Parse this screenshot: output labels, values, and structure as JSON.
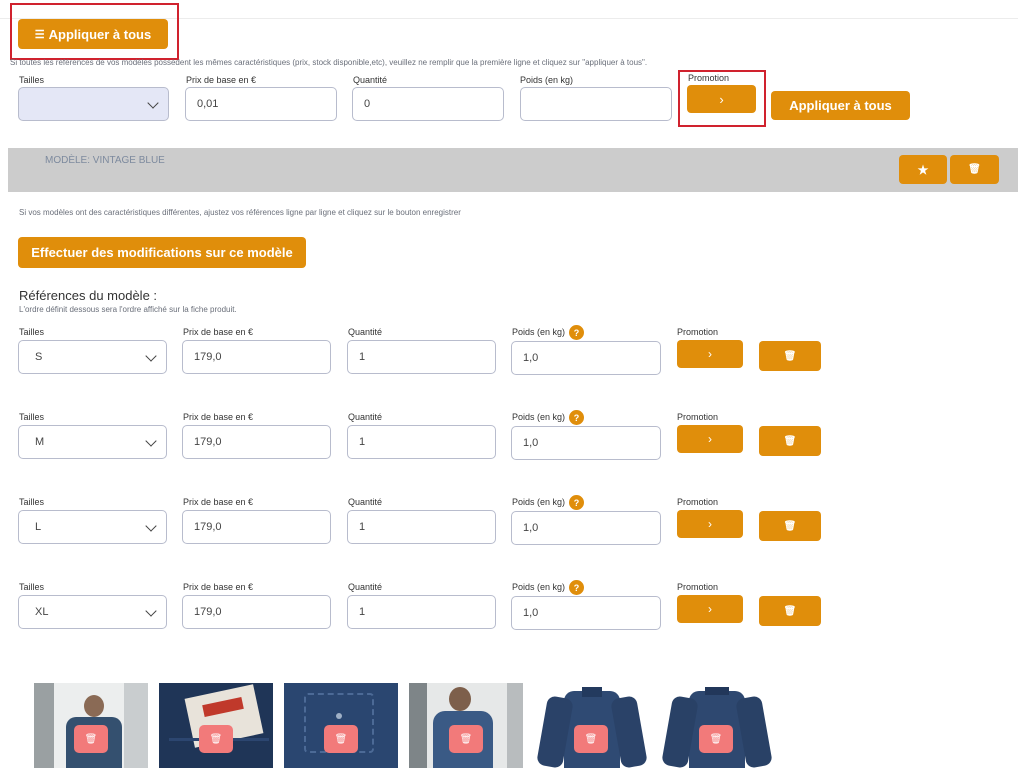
{
  "header": {
    "apply_all_top_label": "Appliquer à tous",
    "instruction": "Si toutes les références de vos modèles possèdent les mêmes caractéristiques (prix, stock disponible,etc), veuillez ne remplir que la première ligne et cliquez sur \"appliquer à tous\"."
  },
  "global_row": {
    "labels": {
      "sizes": "Tailles",
      "price": "Prix de base en €",
      "quantity": "Quantité",
      "weight": "Poids (en kg)",
      "promotion": "Promotion"
    },
    "size_value": "",
    "price_value": "0,01",
    "quantity_value": "0",
    "weight_value": "",
    "promo_arrow": "›",
    "apply_all_label": "Appliquer à tous"
  },
  "model": {
    "title": "MODÈLE: VINTAGE BLUE",
    "star_icon": "★",
    "trash_icon": "🗑",
    "instruction": "Si vos modèles ont des caractéristiques différentes, ajustez vos références ligne par ligne et cliquez sur le bouton enregistrer",
    "edit_button": "Effectuer des modifications sur ce modèle",
    "references_title": "Références du modèle :",
    "references_note": "L'ordre définit dessous sera l'ordre affiché sur la fiche produit."
  },
  "ref_labels": {
    "sizes": "Tailles",
    "price": "Prix de base en €",
    "quantity": "Quantité",
    "weight": "Poids (en kg)",
    "help": "?",
    "promotion": "Promotion"
  },
  "references": [
    {
      "size": "S",
      "price": "179,0",
      "quantity": "1",
      "weight": "1,0"
    },
    {
      "size": "M",
      "price": "179,0",
      "quantity": "1",
      "weight": "1,0"
    },
    {
      "size": "L",
      "price": "179,0",
      "quantity": "1",
      "weight": "1,0"
    },
    {
      "size": "XL",
      "price": "179,0",
      "quantity": "1",
      "weight": "1,0"
    }
  ],
  "images": [
    {
      "name": "photo-man-wearing-shirt"
    },
    {
      "name": "photo-benzak-label"
    },
    {
      "name": "photo-denim-pocket"
    },
    {
      "name": "photo-man-holding-phone"
    },
    {
      "name": "photo-shirt-front"
    },
    {
      "name": "photo-shirt-back"
    }
  ],
  "colors": {
    "accent": "#e08e0b",
    "delete": "#f27a7a",
    "highlight": "#d0222e",
    "bar": "#cccccc"
  }
}
